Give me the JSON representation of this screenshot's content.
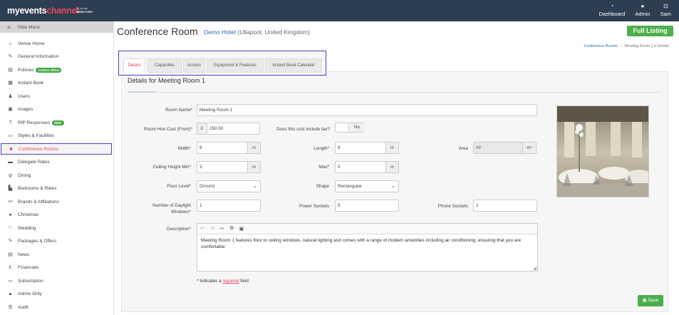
{
  "brand": {
    "logo_main": "myevents",
    "logo_accent": "channel",
    "logo_by": "by",
    "logo_venue": "venue",
    "logo_directory": "DIRECTORY"
  },
  "topnav": [
    {
      "icon": "dashboard-icon",
      "label": "Dashboard"
    },
    {
      "icon": "admin-icon",
      "label": "Admin"
    },
    {
      "icon": "user-icon",
      "label": "Sam"
    }
  ],
  "sidebar": {
    "hide_menu": "Hide Menu",
    "items": [
      {
        "label": "Venue Home",
        "icon": "home-icon"
      },
      {
        "label": "General Information",
        "icon": "edit-icon"
      },
      {
        "label": "Policies",
        "icon": "document-icon",
        "badge": "Carbon Offset"
      },
      {
        "label": "Instant Book",
        "icon": "calendar-icon"
      },
      {
        "label": "Users",
        "icon": "user-icon"
      },
      {
        "label": "Images",
        "icon": "image-icon"
      },
      {
        "label": "RfP Responses",
        "icon": "question-icon",
        "badge": "NEW"
      },
      {
        "label": "Styles & Facilities",
        "icon": "monitor-icon"
      },
      {
        "label": "Conference Rooms",
        "icon": "briefcase-icon",
        "active": true
      },
      {
        "label": "Delegate Rates",
        "icon": "rates-icon"
      },
      {
        "label": "Dining",
        "icon": "dining-icon"
      },
      {
        "label": "Bedrooms & Rates",
        "icon": "bed-icon"
      },
      {
        "label": "Brands & Affiliations",
        "icon": "link-icon"
      },
      {
        "label": "Christmas",
        "icon": "bell-icon"
      },
      {
        "label": "Wedding",
        "icon": "heart-icon"
      },
      {
        "label": "Packages & Offers",
        "icon": "package-icon"
      },
      {
        "label": "News",
        "icon": "news-icon"
      },
      {
        "label": "Financials",
        "icon": "pound-icon"
      },
      {
        "label": "Subscription",
        "icon": "card-icon"
      },
      {
        "label": "Admin Only",
        "icon": "warning-icon"
      },
      {
        "label": "Audit",
        "icon": "list-icon"
      }
    ]
  },
  "header": {
    "title": "Conference Room",
    "hotel": "Demo Hotel",
    "location": "(Ullapool, United Kingdom)",
    "full_listing": "Full Listing"
  },
  "breadcrumb": {
    "link": "Conference Rooms",
    "separator": "/",
    "current": "Meeting Room 1's Details"
  },
  "tabs": [
    "Details",
    "Capacities",
    "Access",
    "Equipment & Features",
    "Instant Book Calendar"
  ],
  "form": {
    "section_title": "Details for Meeting Room 1",
    "room_name_label": "Room Name*",
    "room_name": "Meeting Room 1",
    "hire_cost_label": "Room Hire Cost (From)*",
    "currency": "£",
    "hire_cost": "150.00",
    "tax_label": "Does this cost include tax?",
    "tax_value": "No",
    "width_label": "Width*",
    "width": "6",
    "length_label": "Length*",
    "length": "8",
    "area_label": "Area",
    "area": "48",
    "unit_m": "m",
    "unit_m2": "m²",
    "ceiling_label": "Ceiling Height Min*",
    "ceiling": "3",
    "max_label": "Max*",
    "max": "5",
    "floor_label": "Floor Level*",
    "floor": "Ground",
    "shape_label": "Shape",
    "shape": "Rectangular",
    "windows_label_1": "Number of Daylight",
    "windows_label_2": "Windows*",
    "windows": "1",
    "power_label": "Power Sockets",
    "power": "5",
    "phone_label": "Phone Sockets",
    "phone": "1",
    "description_label": "Description*",
    "description": "Meeting Room 1 features floor to ceiling windows, natural lighting and comes with a range of modern amenities including air conditioning, ensuring that you are comfortable.",
    "required_pre": "* Indicates a",
    "required_word": "required",
    "required_post": "field",
    "save": "Save"
  }
}
